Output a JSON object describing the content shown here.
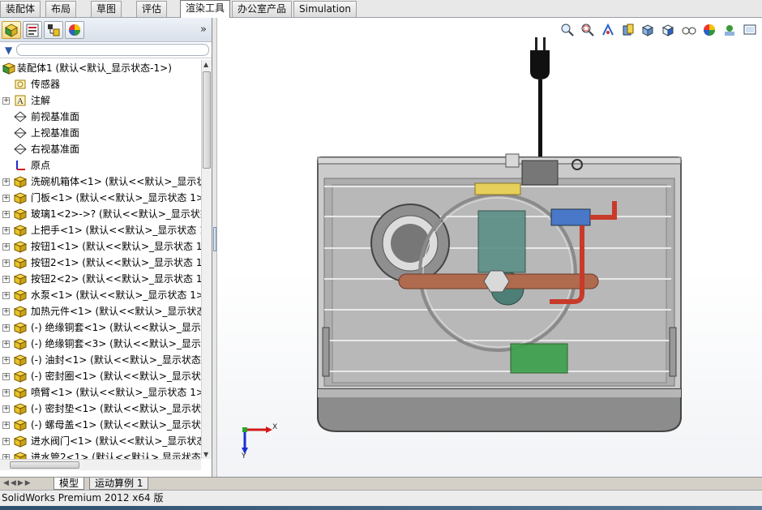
{
  "tabs": [
    "装配体",
    "布局",
    "草图",
    "评估",
    "渲染工具",
    "办公室产品",
    "Simulation"
  ],
  "active_tab": "渲染工具",
  "feature_tree": {
    "root": "装配体1  (默认<默认_显示状态-1>)",
    "items": [
      {
        "label": "传感器",
        "icon": "sensor-icon",
        "expand": false
      },
      {
        "label": "注解",
        "icon": "annotation-icon",
        "expand": true
      },
      {
        "label": "前视基准面",
        "icon": "plane-icon",
        "expand": false
      },
      {
        "label": "上视基准面",
        "icon": "plane-icon",
        "expand": false
      },
      {
        "label": "右视基准面",
        "icon": "plane-icon",
        "expand": false
      },
      {
        "label": "原点",
        "icon": "origin-icon",
        "expand": false
      },
      {
        "label": "洗碗机箱体<1> (默认<<默认>_显示状",
        "icon": "part-icon",
        "expand": true
      },
      {
        "label": "门板<1> (默认<<默认>_显示状态 1>)",
        "icon": "part-icon",
        "expand": true
      },
      {
        "label": "玻璃1<2>->? (默认<<默认>_显示状态",
        "icon": "part-icon",
        "expand": true
      },
      {
        "label": "上把手<1> (默认<<默认>_显示状态 1",
        "icon": "part-icon",
        "expand": true
      },
      {
        "label": "按钮1<1> (默认<<默认>_显示状态 1>",
        "icon": "part-icon",
        "expand": true
      },
      {
        "label": "按钮2<1> (默认<<默认>_显示状态 1>",
        "icon": "part-icon",
        "expand": true
      },
      {
        "label": "按钮2<2> (默认<<默认>_显示状态 1>",
        "icon": "part-icon",
        "expand": true
      },
      {
        "label": "水泵<1> (默认<<默认>_显示状态 1>)",
        "icon": "part-icon",
        "expand": true
      },
      {
        "label": "加热元件<1> (默认<<默认>_显示状态",
        "icon": "part-icon",
        "expand": true
      },
      {
        "label": "(-) 绝缘铜套<1> (默认<<默认>_显示状",
        "icon": "part-icon",
        "expand": true
      },
      {
        "label": "(-) 绝缘铜套<3> (默认<<默认>_显示状",
        "icon": "part-icon",
        "expand": true
      },
      {
        "label": "(-) 油封<1> (默认<<默认>_显示状态 1",
        "icon": "part-icon",
        "expand": true
      },
      {
        "label": "(-) 密封圈<1> (默认<<默认>_显示状态",
        "icon": "part-icon",
        "expand": true
      },
      {
        "label": "喷臂<1> (默认<<默认>_显示状态 1>)",
        "icon": "part-icon",
        "expand": true
      },
      {
        "label": "(-) 密封垫<1> (默认<<默认>_显示状态",
        "icon": "part-icon",
        "expand": true
      },
      {
        "label": "(-) 螺母盖<1> (默认<<默认>_显示状态",
        "icon": "part-icon",
        "expand": true
      },
      {
        "label": "进水阀门<1> (默认<<默认>_显示状态",
        "icon": "part-icon",
        "expand": true
      },
      {
        "label": "进水管2<1> (默认<<默认> 显示状态",
        "icon": "part-icon",
        "expand": true
      }
    ]
  },
  "triad": {
    "x_label": "X",
    "y_label": "Y"
  },
  "bottom_tabs": [
    "模型",
    "运动算例 1"
  ],
  "active_bottom_tab": "模型",
  "status_text": "SolidWorks Premium 2012 x64 版",
  "colors": {
    "part_icon": "#e8c228",
    "tree_line": "#8c8c8c",
    "status_bar": "#ececec"
  }
}
